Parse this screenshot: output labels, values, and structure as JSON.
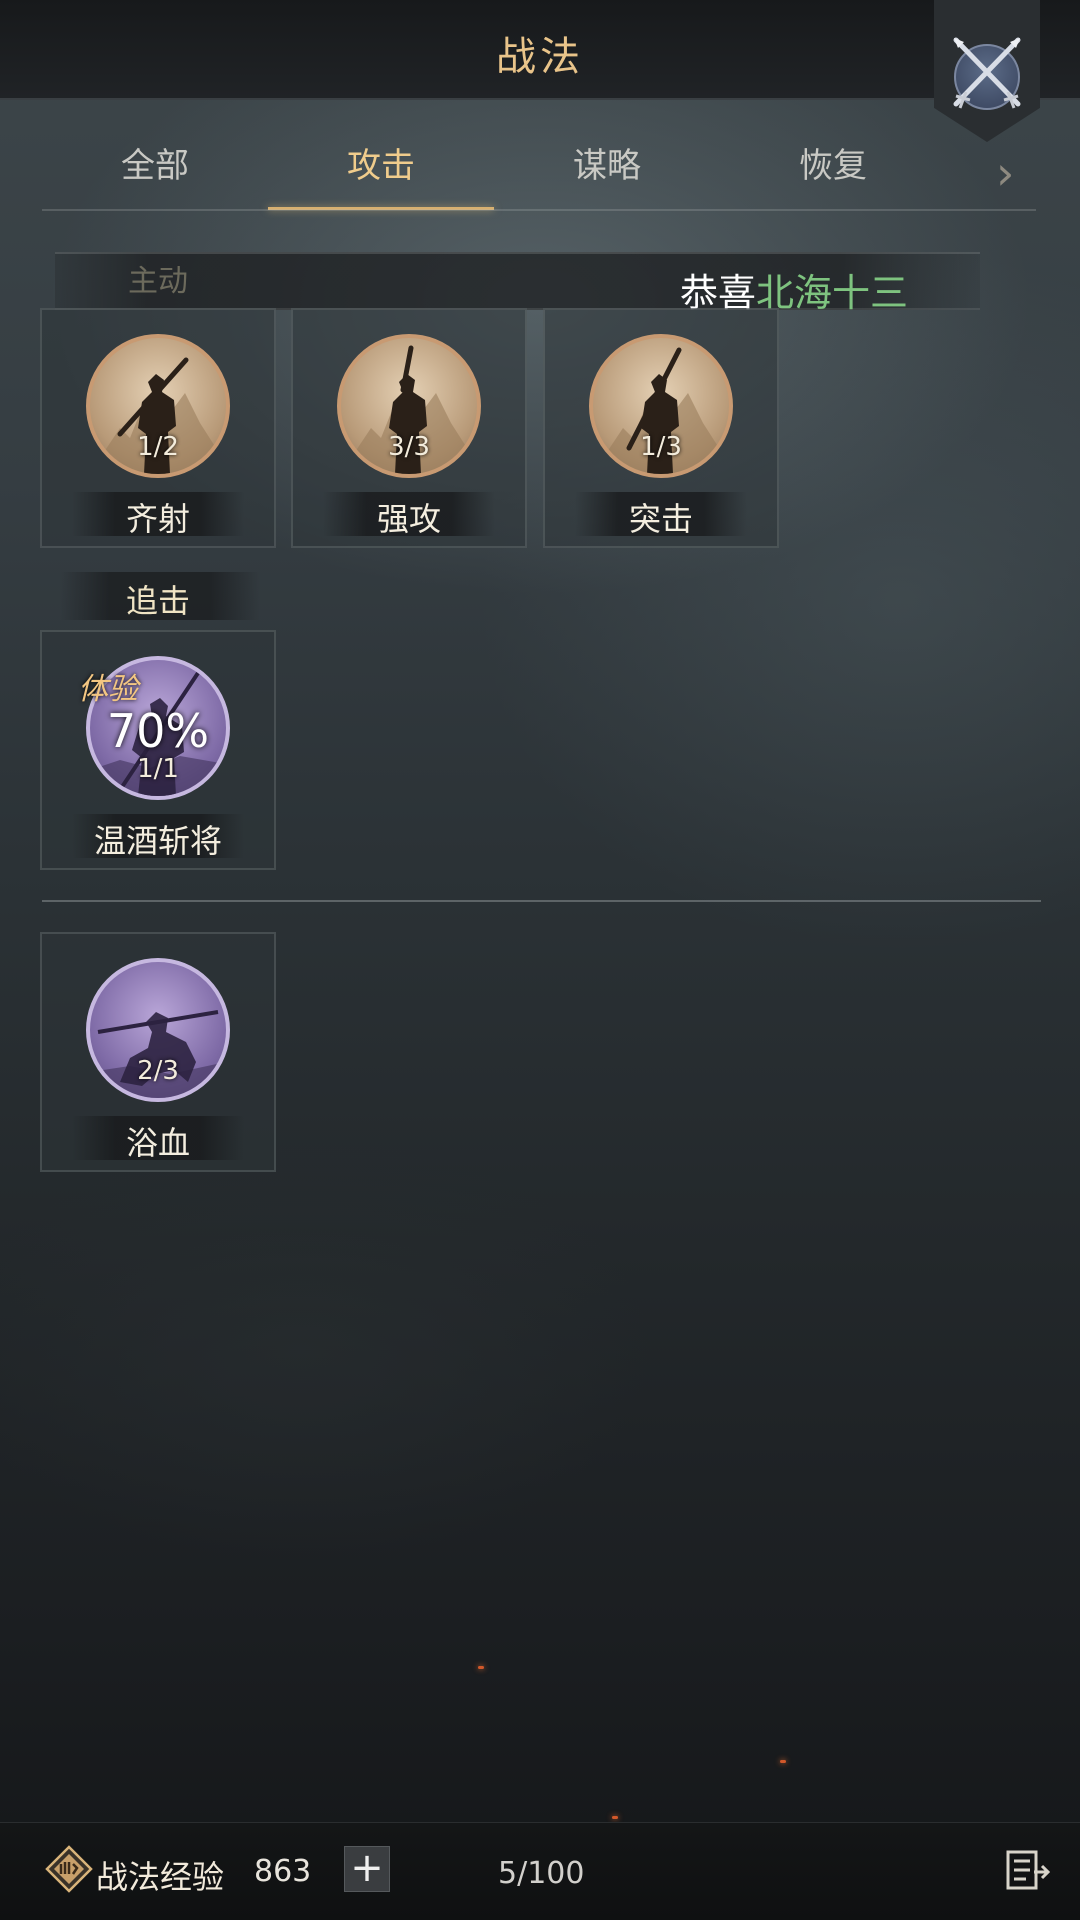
{
  "header": {
    "title": "战法"
  },
  "tabs": [
    {
      "label": "全部",
      "active": false
    },
    {
      "label": "攻击",
      "active": true
    },
    {
      "label": "谋略",
      "active": false
    },
    {
      "label": "恢复",
      "active": false
    }
  ],
  "section": {
    "label": "主动",
    "notice_prefix": "恭喜",
    "notice_name": "北海十三"
  },
  "skills_active": [
    {
      "name": "齐射",
      "count": "1/2",
      "tier": "orange"
    },
    {
      "name": "强攻",
      "count": "3/3",
      "tier": "orange"
    },
    {
      "name": "突击",
      "count": "1/3",
      "tier": "orange"
    }
  ],
  "pursuit": {
    "label": "追击",
    "skill": {
      "name": "温酒斩将",
      "count": "1/1",
      "trial_tag": "体验",
      "trial_pct": "70%",
      "tier": "purple"
    }
  },
  "skills_other": [
    {
      "name": "浴血",
      "count": "2/3",
      "tier": "purple"
    }
  ],
  "bottom": {
    "exp_label": "战法经验",
    "exp_value": "863",
    "plus": "+",
    "slots": "5/100"
  },
  "icons": {
    "close": "crossed-swords-close-icon",
    "tab_arrow": "chevron-right-icon",
    "exp": "tactic-exp-icon",
    "list": "list-exit-icon"
  },
  "colors": {
    "accent_gold": "#f0cc8c",
    "player_name_green": "#7ec37f",
    "orange_tier": "#c89a72",
    "purple_tier": "#c6b8e0"
  }
}
